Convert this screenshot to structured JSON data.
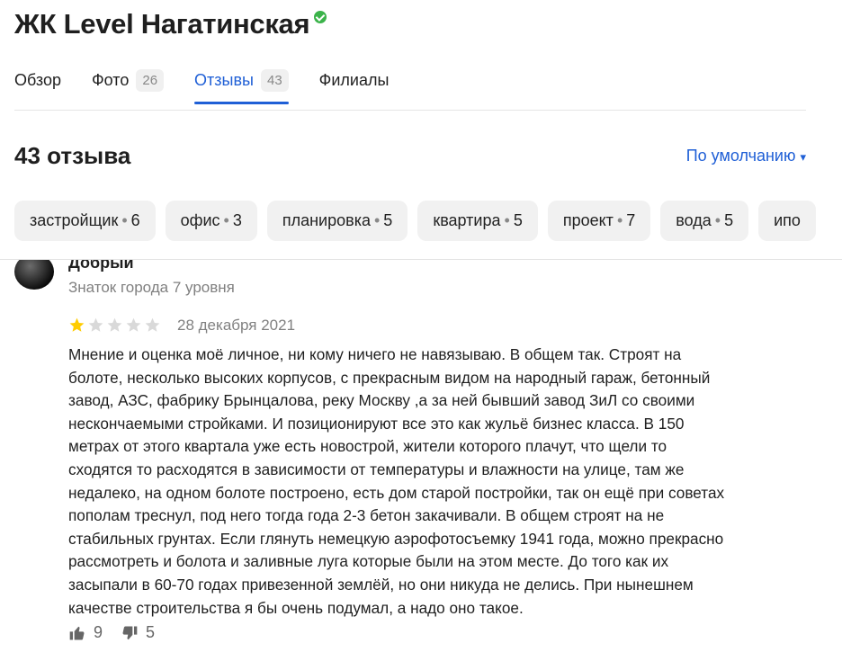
{
  "header": {
    "title": "ЖК Level Нагатинская",
    "verified_icon": "verified-badge-icon"
  },
  "tabs": [
    {
      "label": "Обзор",
      "count": ""
    },
    {
      "label": "Фото",
      "count": "26"
    },
    {
      "label": "Отзывы",
      "count": "43"
    },
    {
      "label": "Филиалы",
      "count": ""
    }
  ],
  "reviews_header": {
    "count_label": "43 отзыва",
    "sort_label": "По умолчанию",
    "sort_arrow": "▾"
  },
  "chips": [
    {
      "name": "застройщик",
      "count": "6"
    },
    {
      "name": "офис",
      "count": "3"
    },
    {
      "name": "планировка",
      "count": "5"
    },
    {
      "name": "квартира",
      "count": "5"
    },
    {
      "name": "проект",
      "count": "7"
    },
    {
      "name": "вода",
      "count": "5"
    },
    {
      "name": "ипо",
      "count": ""
    }
  ],
  "review": {
    "author": "Добрый",
    "level": "Знаток города 7 уровня",
    "rating": 1,
    "rating_max": 5,
    "date": "28 декабря 2021",
    "text_lines": [
      "Мнение и оценка моё личное, ни кому ничего не навязываю. В общем так. Строят на",
      "болоте, несколько высоких корпусов, с прекрасным видом на народный гараж, бетонный",
      "завод, АЗС, фабрику Брынцалова, реку Москву ,а за ней бывший завод ЗиЛ со своими",
      "нескончаемыми стройками. И позиционируют все это как жульё бизнес класса. В 150",
      "метрах от этого квартала уже есть новострой, жители которого плачут, что щели то",
      "сходятся то расходятся в зависимости от температуры и влажности на улице, там же",
      "недалеко, на одном болоте построено, есть дом старой постройки, так он ещё при советах",
      "пополам треснул, под него тогда года 2-3 бетон закачивали. В общем строят на не",
      "стабильных грунтах. Если глянуть немецкую аэрофотосъемку 1941 года, можно прекрасно",
      "рассмотреть и болота и заливные луга которые были на этом месте. До того как их",
      "засыпали в 60-70 годах привезенной землёй, но они никуда не делись. При нынешнем",
      "качестве строительства я бы очень подумал, а надо оно такое."
    ],
    "likes": "9",
    "dislikes": "5"
  },
  "colors": {
    "accent": "#1f5fd6",
    "star_filled": "#fc0",
    "star_empty": "#d9d9d9",
    "verified": "#3bb34a"
  }
}
